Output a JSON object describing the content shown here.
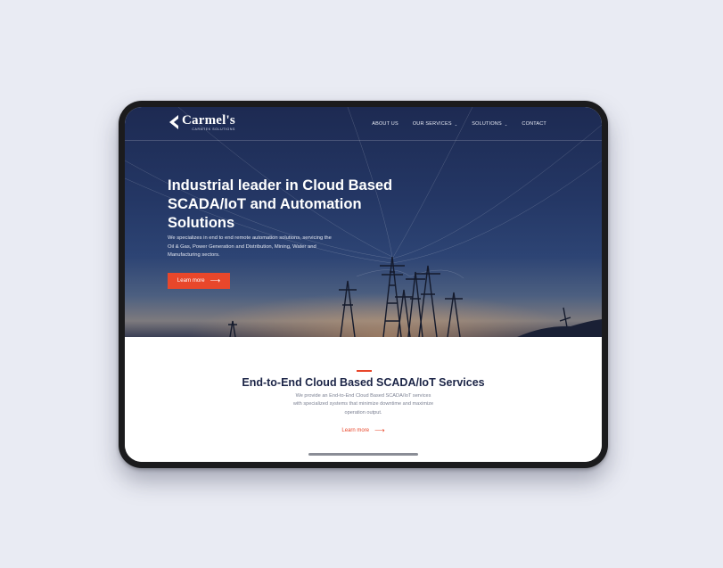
{
  "logo": {
    "name": "Carmel's",
    "subtitle": "CARMTEK SOLUTIONS"
  },
  "nav": {
    "items": [
      {
        "label": "ABOUT US",
        "has_dropdown": false
      },
      {
        "label": "OUR SERVICES",
        "has_dropdown": true
      },
      {
        "label": "SOLUTIONS",
        "has_dropdown": true
      },
      {
        "label": "CONTACT",
        "has_dropdown": false
      }
    ]
  },
  "hero": {
    "title": "Industrial leader in Cloud Based\nSCADA/IoT and Automation\nSolutions",
    "description": "We specializes in end to end remote automation solutions, servicing the Oil & Gas, Power Generation and Distribution, Mining, Water and Manufacturing sectors.",
    "button_label": "Learn more",
    "button_arrow": "⟶"
  },
  "services": {
    "title": "End-to-End Cloud Based SCADA/IoT Services",
    "description": "We provide an End-to-End Cloud Based SCADA/IoT services with specialized systems that minimize downtime and maximize operation output.",
    "link_label": "Learn more",
    "link_arrow": "⟶"
  },
  "colors": {
    "accent": "#e8472b",
    "heading": "#1c2547",
    "hero_dark": "#1d2a52",
    "background": "#e9ebf3"
  }
}
